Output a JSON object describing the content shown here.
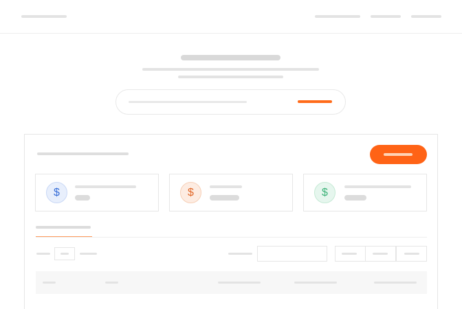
{
  "colors": {
    "accent": "#ff6316",
    "icon_blue": "#3a6fd8",
    "icon_orange": "#e26a2c",
    "icon_green": "#3fb37a"
  },
  "stat_cards": [
    {
      "icon": "dollar-icon",
      "symbol": "$"
    },
    {
      "icon": "dollar-icon",
      "symbol": "$"
    },
    {
      "icon": "dollar-icon",
      "symbol": "$"
    }
  ]
}
